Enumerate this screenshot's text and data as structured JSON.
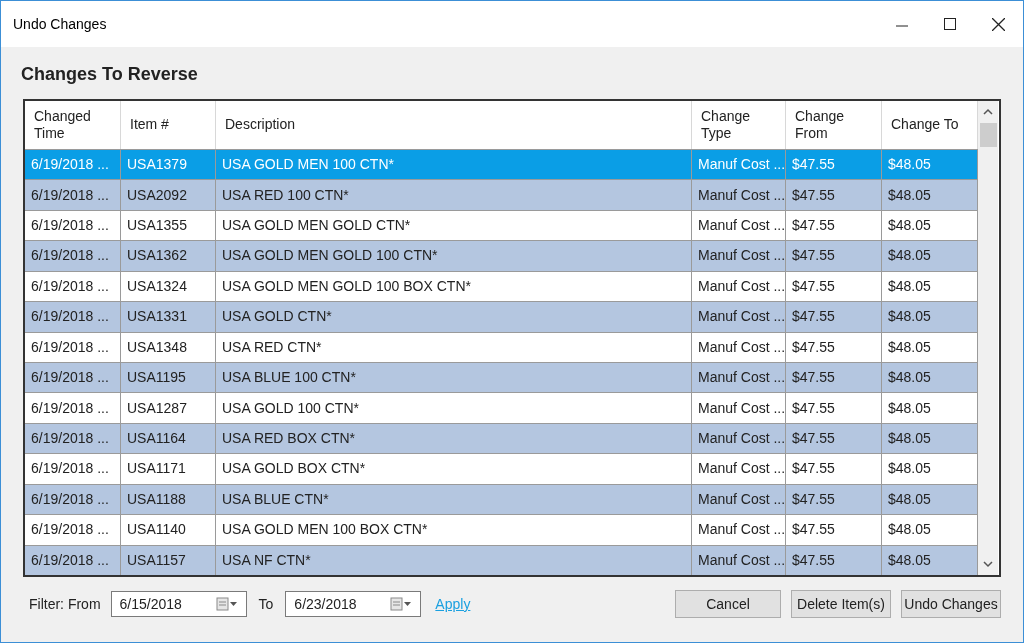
{
  "window": {
    "title": "Undo Changes"
  },
  "heading": "Changes To Reverse",
  "table": {
    "columns": [
      "Changed Time",
      "Item #",
      "Description",
      "Change Type",
      "Change From",
      "Change To"
    ],
    "rows": [
      {
        "selected": true,
        "cells": [
          "6/19/2018 ...",
          "USA1379",
          "USA GOLD MEN 100 CTN*",
          "Manuf Cost ...",
          "$47.55",
          "$48.05"
        ]
      },
      {
        "selected": false,
        "cells": [
          "6/19/2018 ...",
          "USA2092",
          "USA RED 100 CTN*",
          "Manuf Cost ...",
          "$47.55",
          "$48.05"
        ]
      },
      {
        "selected": false,
        "cells": [
          "6/19/2018 ...",
          "USA1355",
          "USA GOLD MEN GOLD CTN*",
          "Manuf Cost ...",
          "$47.55",
          "$48.05"
        ]
      },
      {
        "selected": false,
        "cells": [
          "6/19/2018 ...",
          "USA1362",
          "USA GOLD MEN GOLD  100 CTN*",
          "Manuf Cost ...",
          "$47.55",
          "$48.05"
        ]
      },
      {
        "selected": false,
        "cells": [
          "6/19/2018 ...",
          "USA1324",
          "USA GOLD MEN GOLD 100 BOX CTN*",
          "Manuf Cost ...",
          "$47.55",
          "$48.05"
        ]
      },
      {
        "selected": false,
        "cells": [
          "6/19/2018 ...",
          "USA1331",
          "USA GOLD CTN*",
          "Manuf Cost ...",
          "$47.55",
          "$48.05"
        ]
      },
      {
        "selected": false,
        "cells": [
          "6/19/2018 ...",
          "USA1348",
          "USA RED CTN*",
          "Manuf Cost ...",
          "$47.55",
          "$48.05"
        ]
      },
      {
        "selected": false,
        "cells": [
          "6/19/2018 ...",
          "USA1195",
          "USA BLUE 100 CTN*",
          "Manuf Cost ...",
          "$47.55",
          "$48.05"
        ]
      },
      {
        "selected": false,
        "cells": [
          "6/19/2018 ...",
          "USA1287",
          "USA GOLD 100 CTN*",
          "Manuf Cost ...",
          "$47.55",
          "$48.05"
        ]
      },
      {
        "selected": false,
        "cells": [
          "6/19/2018 ...",
          "USA1164",
          "USA RED BOX CTN*",
          "Manuf Cost ...",
          "$47.55",
          "$48.05"
        ]
      },
      {
        "selected": false,
        "cells": [
          "6/19/2018 ...",
          "USA1171",
          "USA GOLD BOX CTN*",
          "Manuf Cost ...",
          "$47.55",
          "$48.05"
        ]
      },
      {
        "selected": false,
        "cells": [
          "6/19/2018 ...",
          "USA1188",
          "USA BLUE CTN*",
          "Manuf Cost ...",
          "$47.55",
          "$48.05"
        ]
      },
      {
        "selected": false,
        "cells": [
          "6/19/2018 ...",
          "USA1140",
          "USA GOLD MEN 100 BOX CTN*",
          "Manuf Cost ...",
          "$47.55",
          "$48.05"
        ]
      },
      {
        "selected": false,
        "cells": [
          "6/19/2018 ...",
          "USA1157",
          "USA NF CTN*",
          "Manuf Cost ...",
          "$47.55",
          "$48.05"
        ]
      }
    ]
  },
  "filter": {
    "label": "Filter: From",
    "from": "6/15/2018",
    "to_label": "To",
    "to": "6/23/2018",
    "apply": "Apply"
  },
  "buttons": [
    "Cancel",
    "Delete Item(s)",
    "Undo Changes"
  ]
}
